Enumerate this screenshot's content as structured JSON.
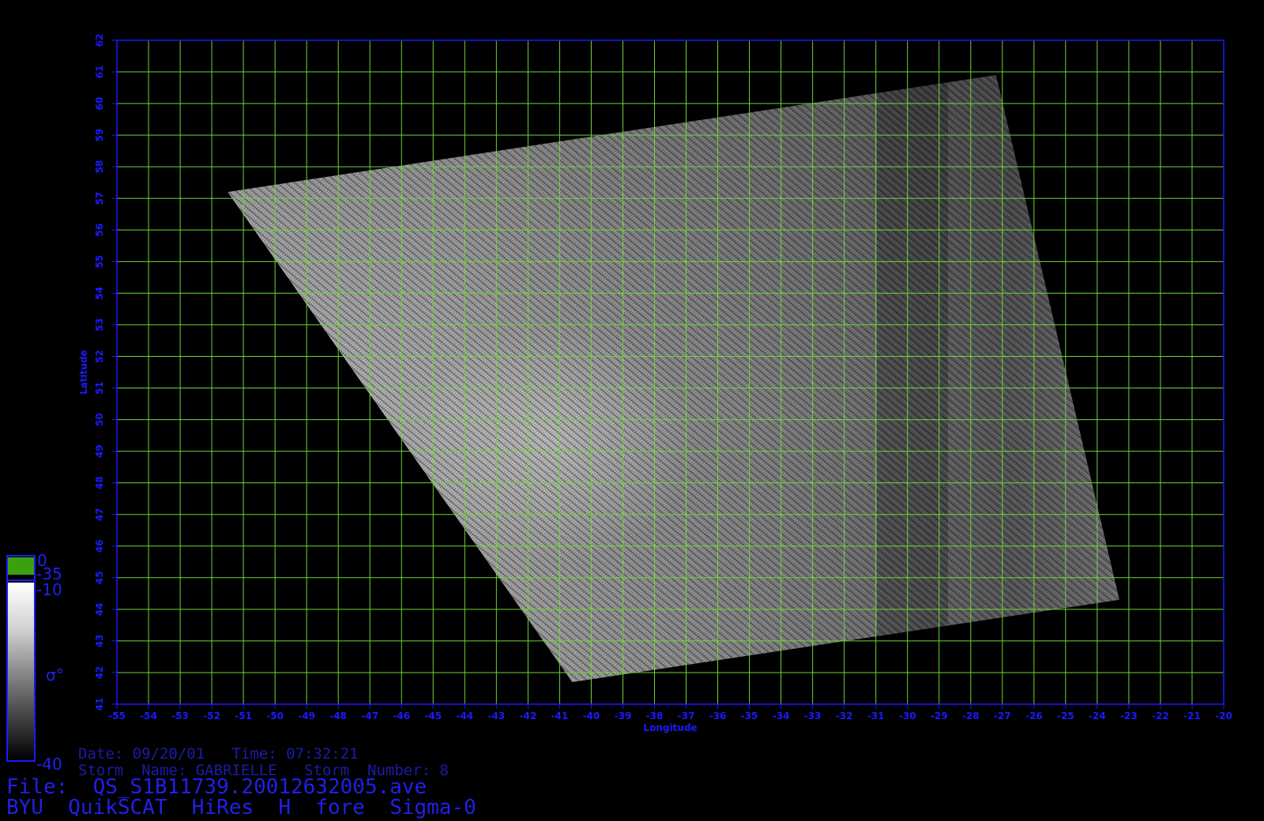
{
  "colors": {
    "axis": "#1a1aff",
    "grid": "#6bd63a",
    "background": "#000000",
    "text_dim": "#1c1ca8",
    "colorbar_land": "#3aa00e"
  },
  "map": {
    "lon_range": [
      -55,
      -20
    ],
    "lat_range": [
      41,
      62
    ],
    "xlabel": "Longitude",
    "ylabel": "Latitude",
    "lon_ticks": [
      "-55",
      "-54",
      "-53",
      "-52",
      "-51",
      "-50",
      "-49",
      "-48",
      "-47",
      "-46",
      "-45",
      "-44",
      "-43",
      "-42",
      "-41",
      "-40",
      "-39",
      "-38",
      "-37",
      "-36",
      "-35",
      "-34",
      "-33",
      "-32",
      "-31",
      "-30",
      "-29",
      "-28",
      "-27",
      "-26",
      "-25",
      "-24",
      "-23",
      "-22",
      "-21",
      "-20"
    ],
    "lat_ticks": [
      "41",
      "42",
      "43",
      "44",
      "45",
      "46",
      "47",
      "48",
      "49",
      "50",
      "51",
      "52",
      "53",
      "54",
      "55",
      "56",
      "57",
      "58",
      "59",
      "60",
      "61",
      "62"
    ],
    "grid": "on",
    "swath_corners_lonlat": [
      [
        -51.5,
        57.2
      ],
      [
        -27.2,
        60.9
      ],
      [
        -23.3,
        44.3
      ],
      [
        -40.6,
        41.7
      ]
    ]
  },
  "colorbar": {
    "labels": {
      "top": "0",
      "land": "-35",
      "max": "-10",
      "min": "-40",
      "symbol": "σ°"
    },
    "range": [
      -40,
      -10
    ]
  },
  "info": {
    "date_line": "Date: 09/20/01   Time: 07:32:21",
    "storm_line": "Storm  Name: GABRIELLE   Storm  Number: 8",
    "file_line": "File:  QS_S1B11739.20012632005.ave",
    "product_line": "BYU  QuikSCAT  HiRes  H  fore  Sigma-0"
  }
}
